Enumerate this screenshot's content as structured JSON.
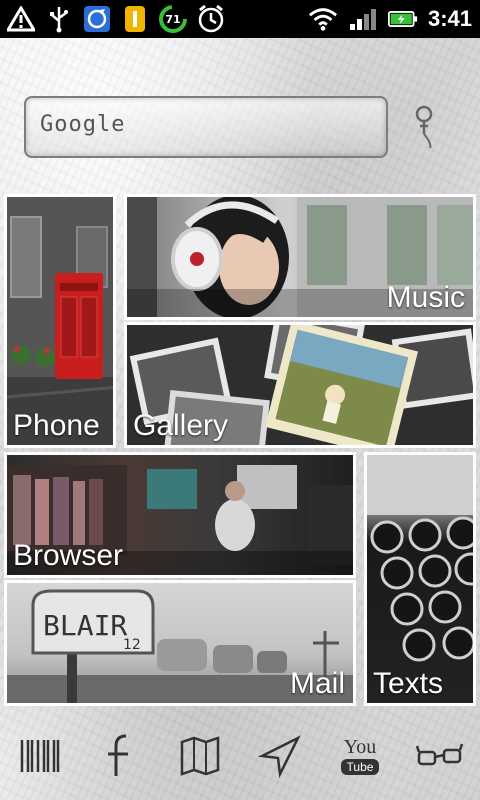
{
  "status_bar": {
    "battery_badge": "71",
    "time": "3:41"
  },
  "search": {
    "placeholder": "Google"
  },
  "tiles": [
    {
      "name": "phone",
      "label": "Phone"
    },
    {
      "name": "music",
      "label": "Music"
    },
    {
      "name": "gallery",
      "label": "Gallery"
    },
    {
      "name": "browser",
      "label": "Browser"
    },
    {
      "name": "mail",
      "label": "Mail"
    },
    {
      "name": "texts",
      "label": "Texts"
    }
  ],
  "mailbox": {
    "sign": "BLAIR",
    "number": "12"
  },
  "dock": {
    "youtube_top": "You",
    "youtube_bottom": "Tube"
  },
  "colors": {
    "status_bar_bg": "#000000",
    "battery_green": "#3bbf3b",
    "phone_booth_red": "#c81e1e",
    "paper_bg": "#e7e7e7"
  }
}
